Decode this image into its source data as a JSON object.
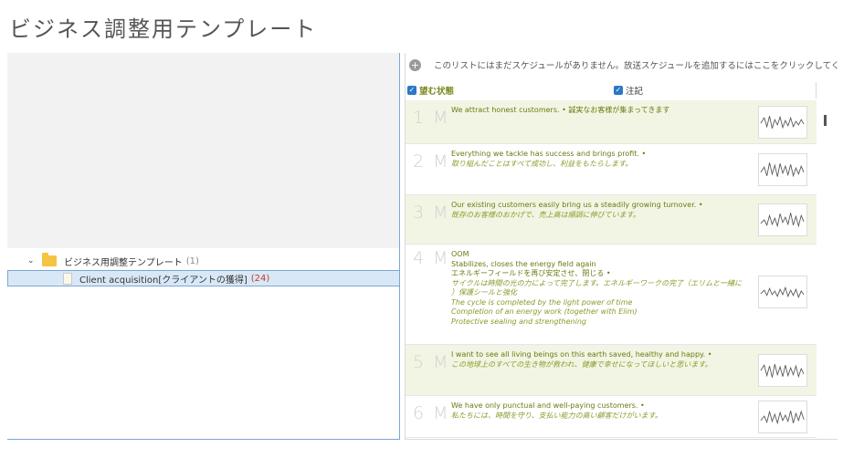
{
  "page_title": "ビジネス調整用テンプレート",
  "tree": {
    "folder": {
      "label": "ビジネス用調整テンプレート",
      "count": "(1)"
    },
    "item": {
      "label": "Client acquisition[クライアントの獲得]",
      "count": "(24)"
    }
  },
  "schedule_bar": {
    "text": "このリストにはまだスケジュールがありません。放送スケジュールを追加するにはここをクリックしてください..."
  },
  "columns": {
    "state": "望む状態",
    "note": "注記"
  },
  "rows": [
    {
      "num": "1 M",
      "lines": [
        {
          "text": "We attract honest customers. • 誠実なお客様が集まってきます",
          "style": "en"
        }
      ]
    },
    {
      "num": "2 M",
      "lines": [
        {
          "text": "Everything we tackle has success and brings profit. •",
          "style": "en"
        },
        {
          "text": "取り組んだことはすべて成功し、利益をもたらします。",
          "style": "it"
        }
      ]
    },
    {
      "num": "3 M",
      "lines": [
        {
          "text": "Our existing customers easily bring us a steadily growing turnover. •",
          "style": "en"
        },
        {
          "text": "既存のお客様のおかげで、売上高は順調に伸びています。",
          "style": "it"
        }
      ]
    },
    {
      "num": "4 M",
      "lines": [
        {
          "text": "OOM",
          "style": "en"
        },
        {
          "text": "Stabilizes, closes the energy field again",
          "style": "en"
        },
        {
          "text": "エネルギーフィールドを再び安定させ、閉じる •",
          "style": "en"
        },
        {
          "text": "サイクルは時間の光の力によって完了します。エネルギーワークの完了（エリムと一緒に",
          "style": "it"
        },
        {
          "text": "）保護シールと強化",
          "style": "it"
        },
        {
          "text": "The cycle is completed by the light power of time",
          "style": "it"
        },
        {
          "text": "Completion of an energy work (together with Elim)",
          "style": "it"
        },
        {
          "text": "Protective sealing and strengthening",
          "style": "it"
        }
      ]
    },
    {
      "num": "5 M",
      "lines": [
        {
          "text": "I want to see all living beings on this earth saved, healthy and happy. •",
          "style": "en"
        },
        {
          "text": "この地球上のすべての生き物が救われ、健康で幸せになってほしいと思います。",
          "style": "it"
        }
      ]
    },
    {
      "num": "6 M",
      "lines": [
        {
          "text": "We have only punctual and well-paying customers. •",
          "style": "en"
        },
        {
          "text": "私たちには、時間を守り、支払い能力の高い顧客だけがいます。",
          "style": "it"
        }
      ]
    }
  ],
  "colors": {
    "accent_green": "#6b7a12",
    "selection_blue": "#d9e8f7",
    "folder_yellow": "#f6c443",
    "checkbox_blue": "#2b78c5"
  }
}
